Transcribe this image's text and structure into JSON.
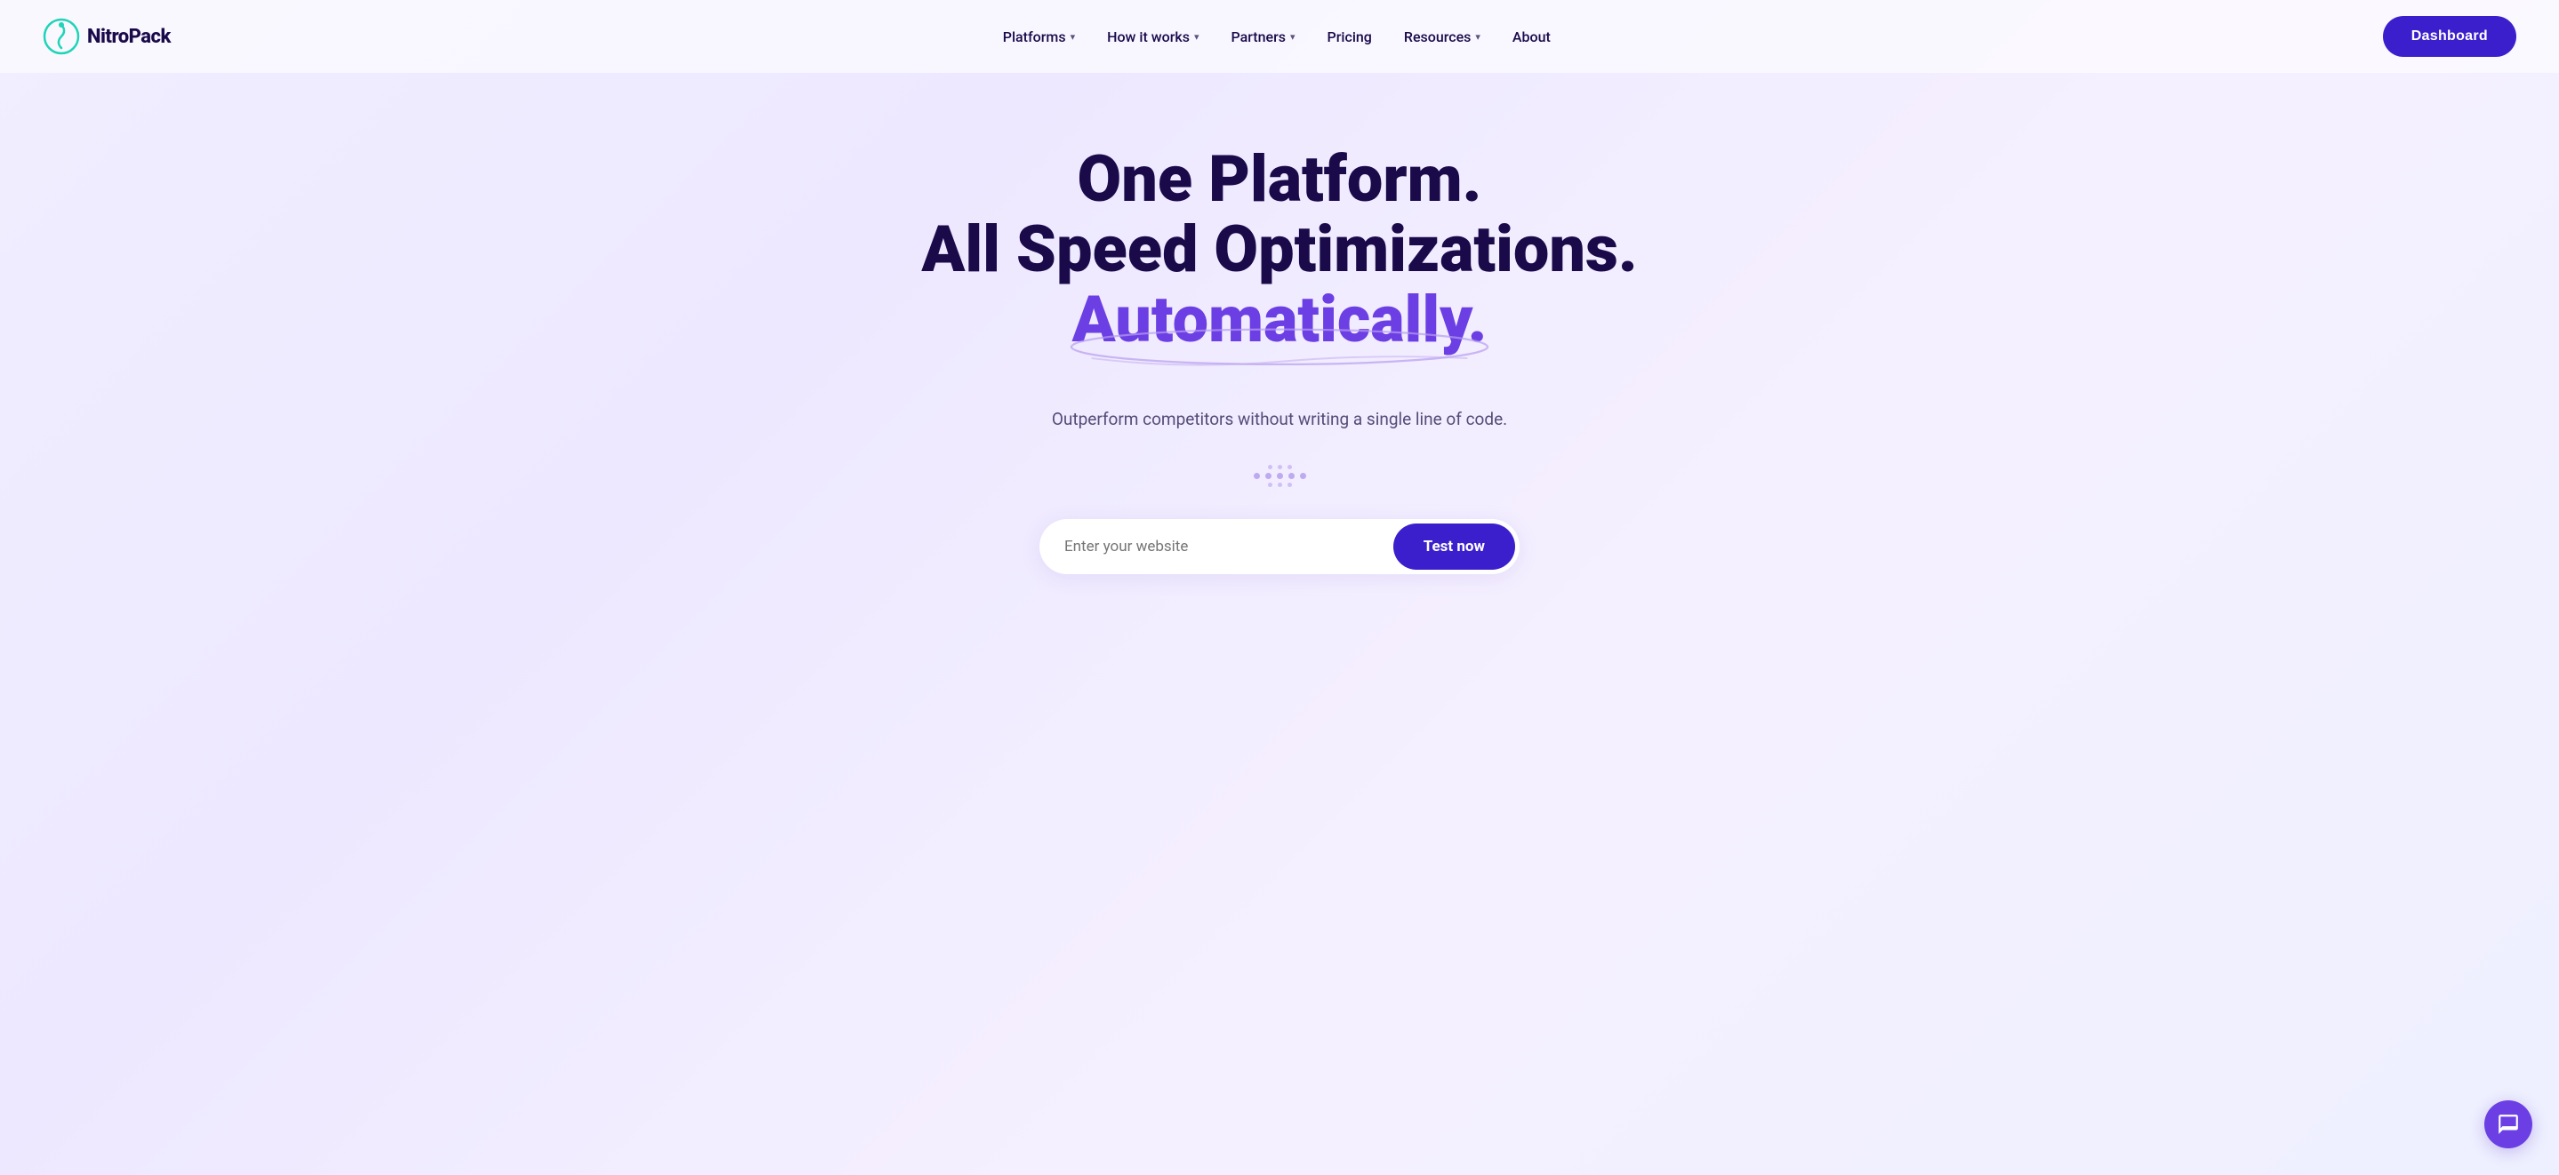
{
  "logo": {
    "text": "NitroPack"
  },
  "nav": {
    "items": [
      {
        "label": "Platforms",
        "hasDropdown": true
      },
      {
        "label": "How it works",
        "hasDropdown": true
      },
      {
        "label": "Partners",
        "hasDropdown": true
      },
      {
        "label": "Pricing",
        "hasDropdown": false
      },
      {
        "label": "Resources",
        "hasDropdown": true
      },
      {
        "label": "About",
        "hasDropdown": false
      }
    ],
    "dashboard_label": "Dashboard"
  },
  "hero": {
    "line1": "One Platform.",
    "line2": "All Speed Optimizations.",
    "line3": "Automatically.",
    "subtitle": "Outperform competitors without writing a single line of code."
  },
  "search": {
    "placeholder": "Enter your website",
    "button_label": "Test now"
  },
  "chat": {
    "label": "chat-support"
  }
}
